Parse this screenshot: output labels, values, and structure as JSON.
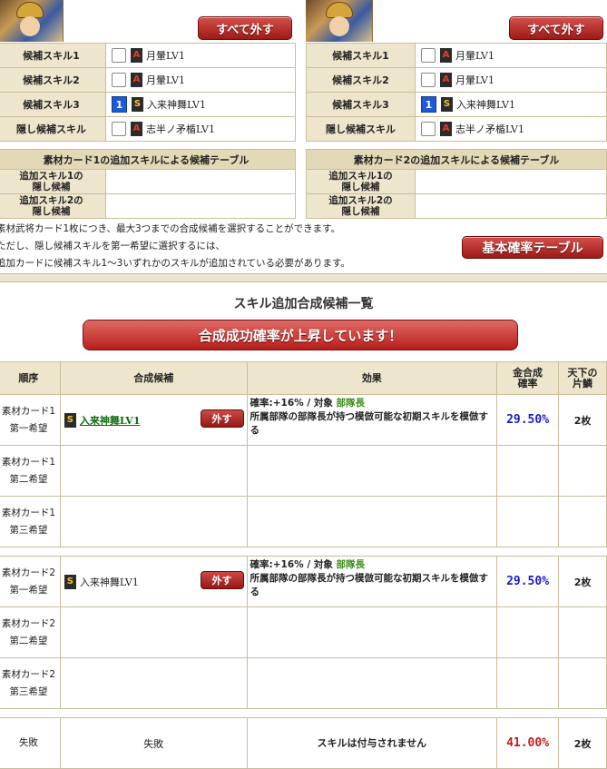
{
  "left_card": {
    "remove_all": "すべて外す",
    "rows": [
      {
        "label": "候補スキル1",
        "badge": "",
        "grade": "A",
        "skill": "月暈LV1"
      },
      {
        "label": "候補スキル2",
        "badge": "",
        "grade": "A",
        "skill": "月暈LV1"
      },
      {
        "label": "候補スキル3",
        "badge": "1",
        "grade": "S",
        "skill": "入来神舞LV1"
      },
      {
        "label": "隠し候補スキル",
        "badge": "",
        "grade": "A",
        "skill": "志半ノ矛楯LV1"
      }
    ],
    "hidden_title": "素材カード1の追加スキルによる候補テーブル",
    "hidden_rows": [
      "追加スキル1の\n隠し候補",
      "追加スキル2の\n隠し候補"
    ]
  },
  "right_card": {
    "remove_all": "すべて外す",
    "rows": [
      {
        "label": "候補スキル1",
        "badge": "",
        "grade": "A",
        "skill": "月暈LV1"
      },
      {
        "label": "候補スキル2",
        "badge": "",
        "grade": "A",
        "skill": "月暈LV1"
      },
      {
        "label": "候補スキル3",
        "badge": "1",
        "grade": "S",
        "skill": "入来神舞LV1"
      },
      {
        "label": "隠し候補スキル",
        "badge": "",
        "grade": "A",
        "skill": "志半ノ矛楯LV1"
      }
    ],
    "hidden_title": "素材カード2の追加スキルによる候補テーブル",
    "hidden_rows": [
      "追加スキル1の\n隠し候補",
      "追加スキル2の\n隠し候補"
    ]
  },
  "notes": [
    "素材武将カード1枚につき、最大3つまでの合成候補を選択することができます。",
    "ただし、隠し候補スキルを第一希望に選択するには、",
    "追加カードに候補スキル1～3いずれかのスキルが追加されている必要があります。"
  ],
  "basic_prob_button": "基本確率テーブル",
  "list_title": "スキル追加合成候補一覧",
  "banner": "合成成功確率が上昇しています！",
  "table": {
    "headers": {
      "order": "順序",
      "candidate": "合成候補",
      "effect": "効果",
      "rate": "金合成\n確率",
      "piece": "天下の\n片鱗"
    },
    "remove_label": "外す",
    "groups": [
      [
        {
          "order": "素材カード1\n第一希望",
          "grade": "S",
          "skill": "入来神舞LV1",
          "link": true,
          "effect_label": "確率:+16%  /  対象",
          "effect_target": "部隊長",
          "effect_desc": "所属部隊の部隊長が持つ模倣可能な初期スキルを模倣する",
          "rate": "29.50%",
          "piece": "2枚"
        },
        {
          "order": "素材カード1\n第二希望"
        },
        {
          "order": "素材カード1\n第三希望"
        }
      ],
      [
        {
          "order": "素材カード2\n第一希望",
          "grade": "S",
          "skill": "入来神舞LV1",
          "link": false,
          "effect_label": "確率:+16%  /  対象",
          "effect_target": "部隊長",
          "effect_desc": "所属部隊の部隊長が持つ模倣可能な初期スキルを模倣する",
          "rate": "29.50%",
          "piece": "2枚"
        },
        {
          "order": "素材カード2\n第二希望"
        },
        {
          "order": "素材カード2\n第三希望"
        }
      ]
    ],
    "fail_row": {
      "order": "失敗",
      "candidate": "失敗",
      "effect": "スキルは付与されません",
      "rate": "41.00%",
      "piece": "2枚"
    }
  }
}
